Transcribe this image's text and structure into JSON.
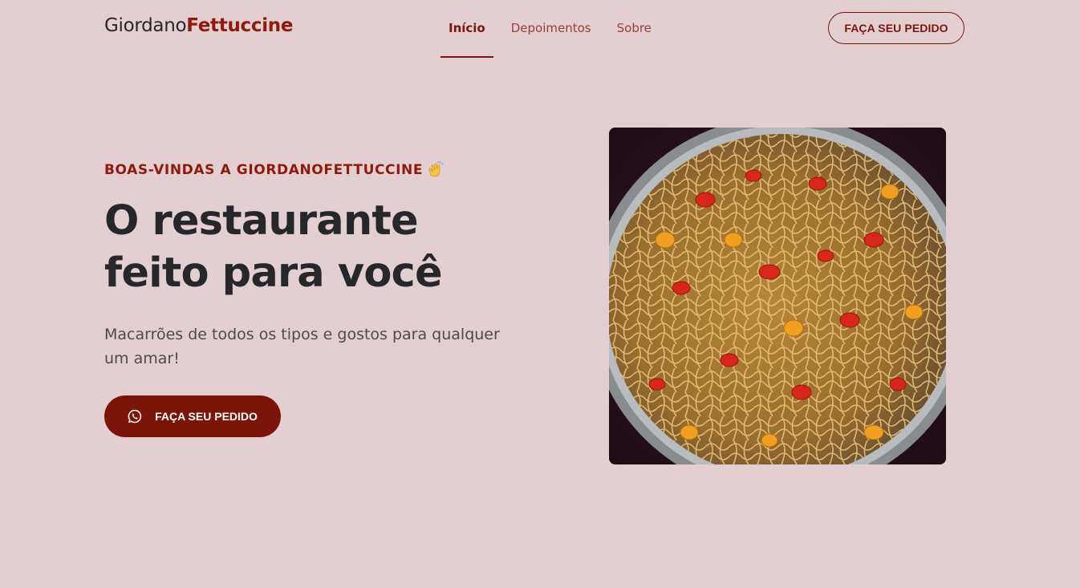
{
  "header": {
    "logo": {
      "part1": "Giordano",
      "part2": "Fettuccine"
    },
    "nav": [
      {
        "label": "Início",
        "active": true
      },
      {
        "label": "Depoimentos",
        "active": false
      },
      {
        "label": "Sobre",
        "active": false
      }
    ],
    "order_button": "FAÇA SEU PEDIDO"
  },
  "hero": {
    "welcome": "BOAS-VINDAS A GIORDANOFETTUCCINE",
    "welcome_icon": "clapping-hands-icon",
    "title": "O restaurante feito para você",
    "subtitle": "Macarrões de todos os tipos e gostos para qualquer um amar!",
    "cta_label": "FAÇA SEU PEDIDO",
    "cta_icon": "whatsapp-icon",
    "image_description": "spaghetti-with-tomatoes-pan"
  },
  "colors": {
    "background": "#e3cfd2",
    "accent": "#7c1509",
    "accent_text": "#8e1a0b",
    "text": "#26272b"
  }
}
